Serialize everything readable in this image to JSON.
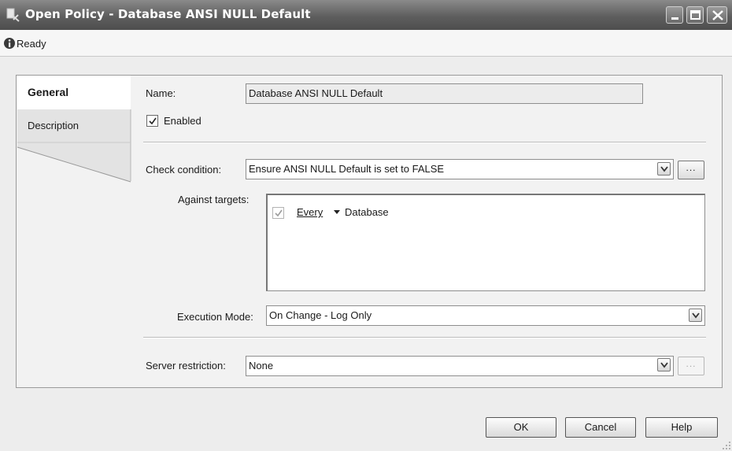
{
  "window": {
    "title": "Open Policy - Database ANSI NULL Default",
    "icons": {
      "app": "policy-icon",
      "minimize": "minimize-icon",
      "maximize": "maximize-icon",
      "close": "close-icon"
    }
  },
  "status": {
    "text": "Ready",
    "icon": "info-icon"
  },
  "tabs": [
    {
      "label": "General",
      "selected": true
    },
    {
      "label": "Description",
      "selected": false
    }
  ],
  "general": {
    "name_label": "Name:",
    "name_value": "Database ANSI NULL Default",
    "enabled_label": "Enabled",
    "enabled_checked": true,
    "check_condition_label": "Check condition:",
    "check_condition_value": "Ensure ANSI NULL Default is set to FALSE",
    "ellipsis": "...",
    "against_targets_label": "Against targets:",
    "target": {
      "checked": true,
      "quantifier": "Every",
      "object": "Database"
    },
    "execution_mode_label": "Execution Mode:",
    "execution_mode_value": "On Change - Log Only",
    "server_restriction_label": "Server restriction:",
    "server_restriction_value": "None"
  },
  "buttons": {
    "ok": "OK",
    "cancel": "Cancel",
    "help": "Help"
  }
}
